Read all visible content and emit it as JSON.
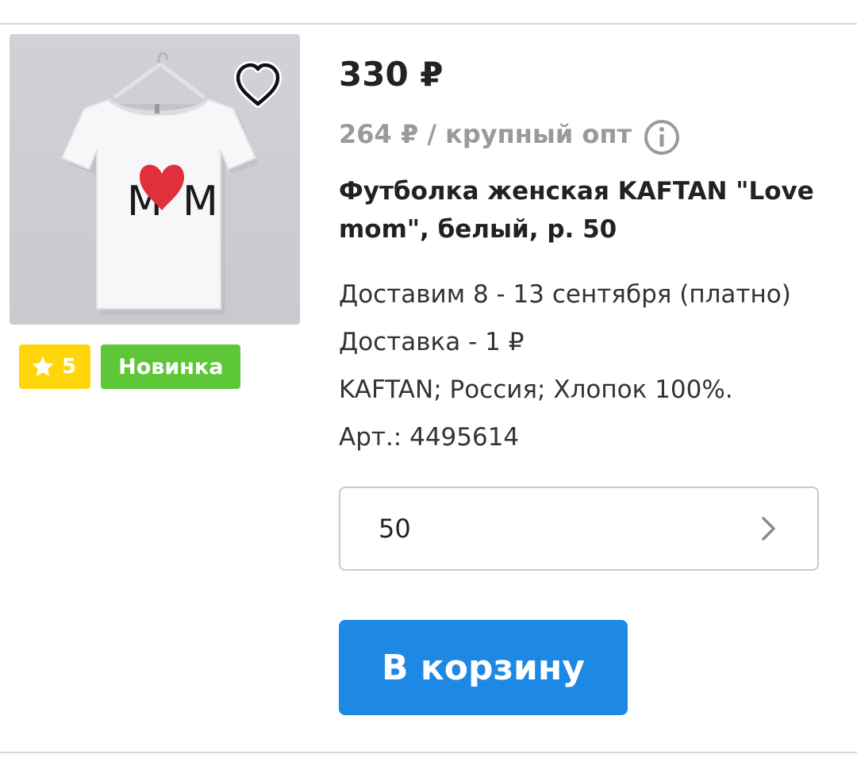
{
  "product": {
    "price": "330 ₽",
    "wholesale_price": "264 ₽ / крупный опт",
    "title": "Футболка женская KAFTAN \"Love mom\", белый, р. 50",
    "delivery_date": "Доставим 8 - 13 сентября (платно)",
    "delivery_cost": "Доставка - 1 ₽",
    "attributes": "KAFTAN; Россия; Хлопок 100%.",
    "article": "Арт.: 4495614",
    "print_text_left": "M",
    "print_text_right": "M"
  },
  "badges": {
    "rating": "5",
    "new_label": "Новинка",
    "rating_color": "#FFD60A",
    "new_color": "#5EC737"
  },
  "size_select": {
    "value": "50"
  },
  "cart_button": {
    "label": "В корзину",
    "color": "#1E88E5"
  },
  "icons": {
    "favorite": "heart-outline-icon",
    "info": "info-circle-icon",
    "star": "star-icon",
    "chevron": "chevron-right-icon"
  }
}
